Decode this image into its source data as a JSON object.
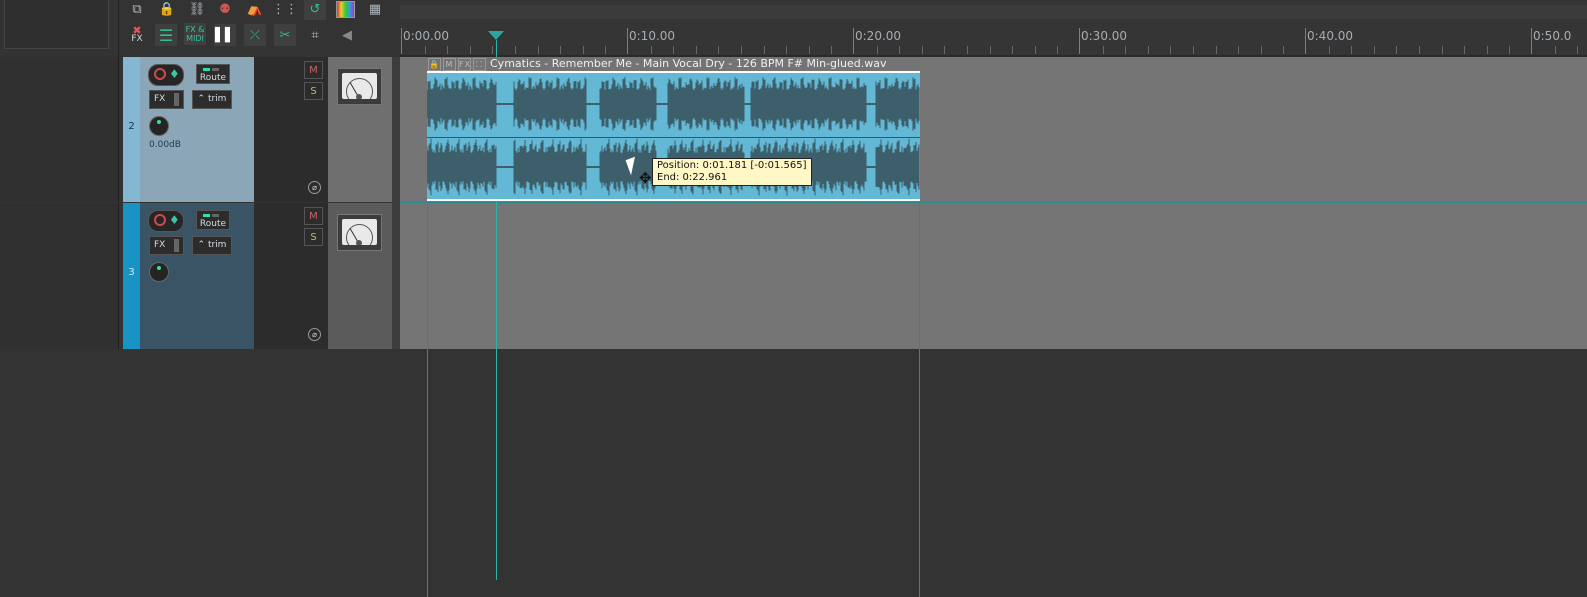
{
  "toolbar": {
    "row1_icons": [
      "copy-icon",
      "lock-icon",
      "link-icon",
      "record-groups-icon",
      "metronome-icon",
      "grid-icon",
      "loop-icon",
      "color-icon",
      "apps-icon"
    ],
    "fx_label": "FX",
    "fxmidi_label_line1": "FX &",
    "fxmidi_label_line2": "MIDI"
  },
  "ruler": {
    "ticks": [
      {
        "label": "0:00.00",
        "seconds": 0
      },
      {
        "label": "0:10.00",
        "seconds": 10
      },
      {
        "label": "0:20.00",
        "seconds": 20
      },
      {
        "label": "0:30.00",
        "seconds": 30
      },
      {
        "label": "0:40.00",
        "seconds": 40
      },
      {
        "label": "0:50.0",
        "seconds": 50
      }
    ]
  },
  "tracks": [
    {
      "number": "2",
      "selected": true,
      "route_label": "Route",
      "fx_label": "FX",
      "trim_label": "trim",
      "volume_label": "0.00dB",
      "mute_label": "M",
      "solo_label": "S",
      "phase_label": "⌀"
    },
    {
      "number": "3",
      "selected": false,
      "route_label": "Route",
      "fx_label": "FX",
      "trim_label": "trim",
      "volume_label": "",
      "mute_label": "M",
      "solo_label": "S",
      "phase_label": "⌀"
    }
  ],
  "item": {
    "title": "Cymatics - Remember Me - Main Vocal Dry - 126 BPM F# Min-glued.wav",
    "header_icons": [
      "lock-icon",
      "mute-icon",
      "fx-icon",
      "envelope-icon"
    ],
    "header_icon_glyphs": [
      "🔒",
      "M",
      "FX",
      "⛶"
    ]
  },
  "tooltip": {
    "line1": "Position: 0:01.181 [-0:01.565]",
    "line2": "End: 0:22.961"
  },
  "colors": {
    "item_fill": "#63b8d6",
    "waveform": "#3d5f6b",
    "track_selected": "#7f9aaa",
    "track_unselected": "#3a5362",
    "grid_line": "#2b8a8f",
    "lane": "#757575"
  }
}
